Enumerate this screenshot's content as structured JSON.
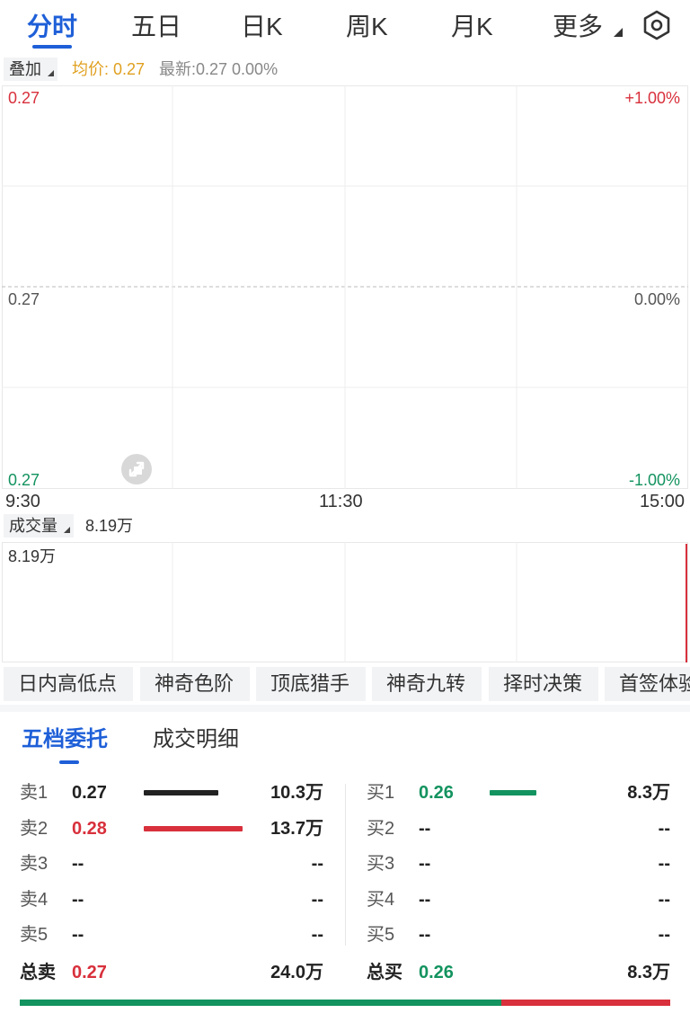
{
  "tabs": {
    "items": [
      {
        "label": "分时",
        "active": true
      },
      {
        "label": "五日"
      },
      {
        "label": "日K"
      },
      {
        "label": "周K"
      },
      {
        "label": "月K"
      },
      {
        "label": "更多"
      }
    ],
    "settings_icon": "settings-hex-icon"
  },
  "overlay": {
    "chip_label": "叠加",
    "avg_price": "均价: 0.27",
    "latest": "最新:0.27 0.00%"
  },
  "price_chart": {
    "left_top": "0.27",
    "left_mid": "0.27",
    "left_bottom": "0.27",
    "right_top": "+1.00%",
    "right_mid": "0.00%",
    "right_bottom": "-1.00%",
    "time_start": "9:30",
    "time_mid": "11:30",
    "time_end": "15:00",
    "expand_icon": "expand-icon"
  },
  "volume_chart": {
    "chip_label": "成交量",
    "value": "8.19万",
    "axis_top": "8.19万",
    "last_bar_fraction": 1.0
  },
  "tools": [
    "日内高低点",
    "神奇色阶",
    "顶底猎手",
    "神奇九转",
    "择时决策",
    "首签体验"
  ],
  "order_book": {
    "tabs": [
      {
        "label": "五档委托",
        "active": true
      },
      {
        "label": "成交明细"
      }
    ],
    "sell": [
      {
        "label": "卖1",
        "price": "0.27",
        "volume": "10.3万",
        "bar_fraction": 0.75
      },
      {
        "label": "卖2",
        "price": "0.28",
        "volume": "13.7万",
        "bar_fraction": 1.0
      },
      {
        "label": "卖3",
        "price": "--",
        "volume": "--"
      },
      {
        "label": "卖4",
        "price": "--",
        "volume": "--"
      },
      {
        "label": "卖5",
        "price": "--",
        "volume": "--"
      }
    ],
    "buy": [
      {
        "label": "买1",
        "price": "0.26",
        "volume": "8.3万",
        "bar_fraction": 0.6
      },
      {
        "label": "买2",
        "price": "--",
        "volume": "--"
      },
      {
        "label": "买3",
        "price": "--",
        "volume": "--"
      },
      {
        "label": "买4",
        "price": "--",
        "volume": "--"
      },
      {
        "label": "买5",
        "price": "--",
        "volume": "--"
      }
    ],
    "total_sell": {
      "label": "总卖",
      "price": "0.27",
      "volume": "24.0万"
    },
    "total_buy": {
      "label": "总买",
      "price": "0.26",
      "volume": "8.3万"
    },
    "buy_share_fraction": 0.74
  },
  "colors": {
    "accent": "#1e5fd8",
    "up": "#d8303c",
    "down": "#13935f",
    "avg": "#e0a020",
    "sell1_bar": "#222222"
  }
}
